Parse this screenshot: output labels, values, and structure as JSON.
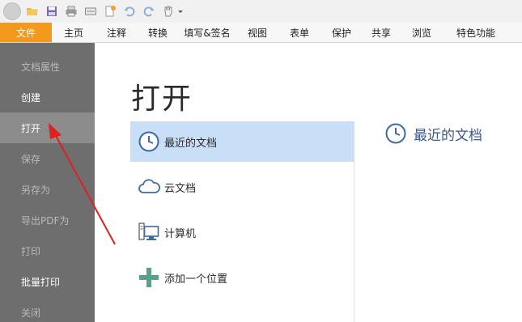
{
  "quick_access": {
    "icons": [
      "avatar",
      "open-folder-icon",
      "save-icon",
      "print-icon",
      "scan-icon",
      "new-icon",
      "undo-icon",
      "redo-icon",
      "hand-tool-icon",
      "dropdown-arrow-icon"
    ]
  },
  "ribbon": {
    "tabs": [
      "文件",
      "主页",
      "注释",
      "转换",
      "填写&签名",
      "视图",
      "表单",
      "保护",
      "共享",
      "浏览",
      "特色功能"
    ],
    "active_color": "#f39a1e"
  },
  "sidebar": {
    "items": [
      "文档属性",
      "创建",
      "打开",
      "保存",
      "另存为",
      "导出PDF为",
      "打印",
      "批量打印",
      "关闭"
    ],
    "selected": "打开"
  },
  "main": {
    "title": "打开",
    "locations": [
      "最近的文档",
      "云文档",
      "计算机",
      "添加一个位置"
    ],
    "selected_location": "最近的文档",
    "recent_heading": "最近的文档"
  },
  "colors": {
    "sidebar_bg": "#6e6e6e",
    "sidebar_active": "#8c8c8c",
    "selected_location": "#c9def7",
    "annotation_arrow": "#e02020"
  }
}
